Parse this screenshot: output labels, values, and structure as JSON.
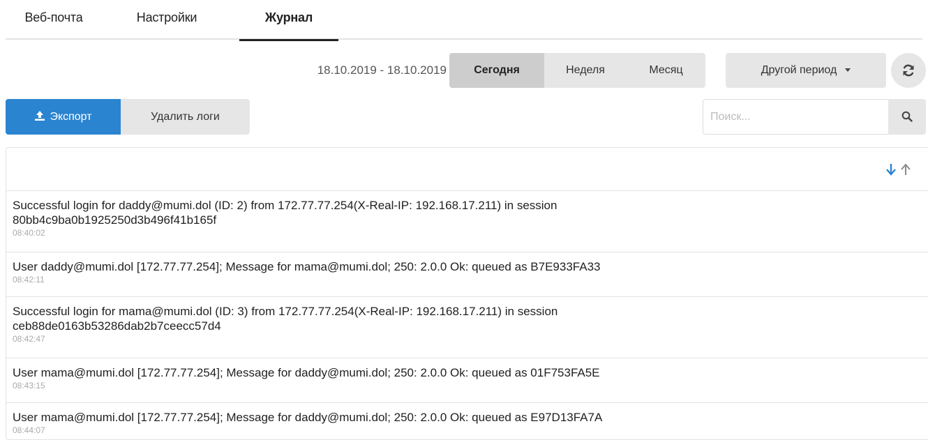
{
  "tabs": [
    {
      "label": "Веб-почта",
      "active": false
    },
    {
      "label": "Настройки",
      "active": false
    },
    {
      "label": "Журнал",
      "active": true
    }
  ],
  "period": {
    "date_range": "18.10.2019 - 18.10.2019",
    "today_label": "Сегодня",
    "week_label": "Неделя",
    "month_label": "Месяц",
    "other_label": "Другой период",
    "selected": "Сегодня"
  },
  "actions": {
    "export_label": "Экспорт",
    "delete_label": "Удалить логи"
  },
  "search": {
    "placeholder": "Поиск...",
    "value": ""
  },
  "colors": {
    "accent": "#2a84d0",
    "button_bg": "#e6e6e6",
    "button_active_bg": "#cdcdcd",
    "timestamp": "#a9a9a9"
  },
  "icons": {
    "export": "upload-icon",
    "refresh": "refresh-icon",
    "search": "search-icon",
    "sort": "sort-arrows-icon",
    "dropdown": "caret-down-icon"
  },
  "logs": [
    {
      "message": "Successful login for daddy@mumi.dol (ID: 2) from 172.77.77.254(X-Real-IP: 192.168.17.211) in session 80bb4c9ba0b1925250d3b496f41b165f",
      "time": "08:40:02"
    },
    {
      "message": "User daddy@mumi.dol [172.77.77.254]; Message for mama@mumi.dol; 250: 2.0.0 Ok: queued as B7E933FA33",
      "time": "08:42:11"
    },
    {
      "message": "Successful login for mama@mumi.dol (ID: 3) from 172.77.77.254(X-Real-IP: 192.168.17.211) in session ceb88de0163b53286dab2b7ceecc57d4",
      "time": "08:42:47"
    },
    {
      "message": "User mama@mumi.dol [172.77.77.254]; Message for daddy@mumi.dol; 250: 2.0.0 Ok: queued as 01F753FA5E",
      "time": "08:43:15"
    },
    {
      "message": "User mama@mumi.dol [172.77.77.254]; Message for daddy@mumi.dol; 250: 2.0.0 Ok: queued as E97D13FA7A",
      "time": "08:44:07"
    }
  ]
}
